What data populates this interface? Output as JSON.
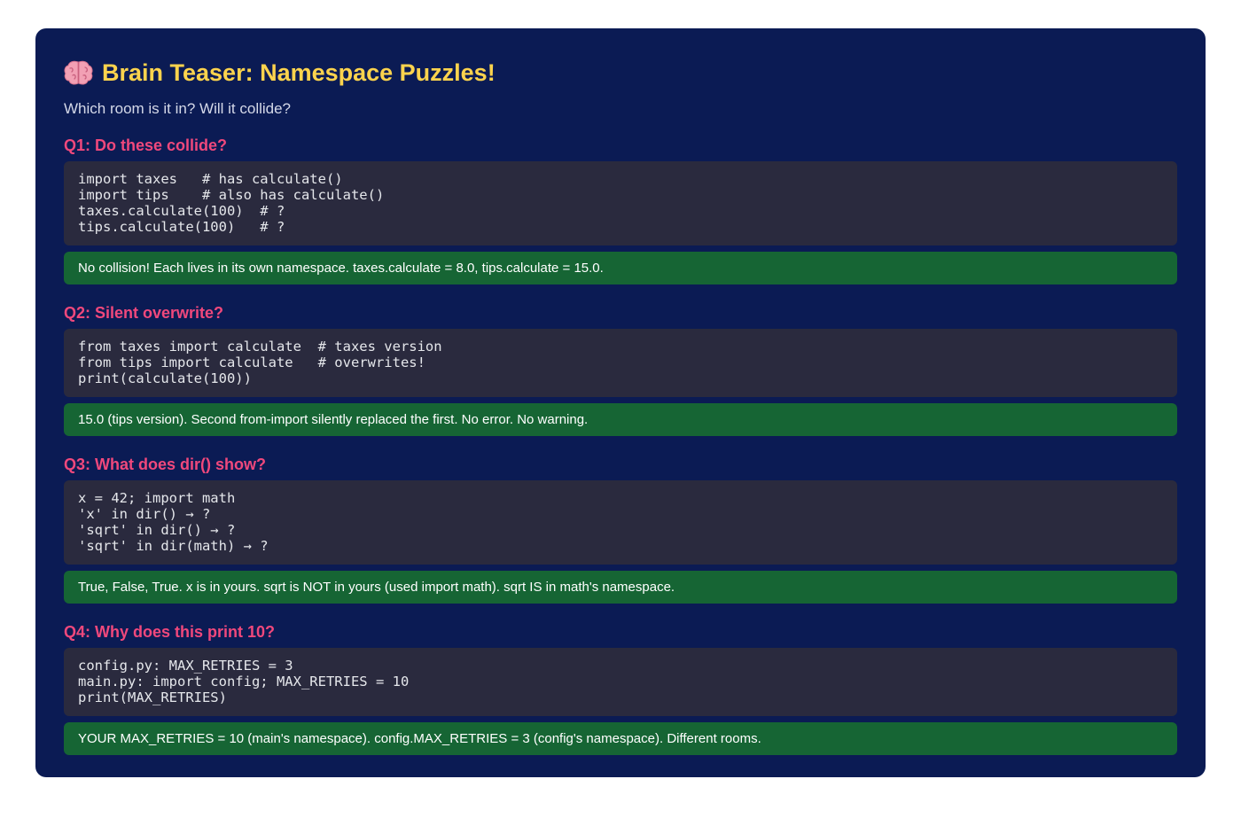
{
  "header": {
    "title": "Brain Teaser: Namespace Puzzles!",
    "icon": "brain-icon",
    "subtitle": "Which room is it in? Will it collide?"
  },
  "colors": {
    "card_background": "#0b1b54",
    "title": "#fcd34d",
    "question": "#f0487c",
    "code_background": "#2a2a3e",
    "answer_background": "#166534"
  },
  "questions": [
    {
      "heading": "Q1: Do these collide?",
      "code": [
        "import taxes   # has calculate()",
        "import tips    # also has calculate()",
        "taxes.calculate(100)  # ?",
        "tips.calculate(100)   # ?"
      ],
      "answer": "No collision! Each lives in its own namespace. taxes.calculate = 8.0, tips.calculate = 15.0."
    },
    {
      "heading": "Q2: Silent overwrite?",
      "code": [
        "from taxes import calculate  # taxes version",
        "from tips import calculate   # overwrites!",
        "print(calculate(100))"
      ],
      "answer": "15.0 (tips version). Second from-import silently replaced the first. No error. No warning."
    },
    {
      "heading": "Q3: What does dir() show?",
      "code": [
        "x = 42; import math",
        "'x' in dir() → ?",
        "'sqrt' in dir() → ?",
        "'sqrt' in dir(math) → ?"
      ],
      "answer": "True, False, True. x is in yours. sqrt is NOT in yours (used import math). sqrt IS in math's namespace."
    },
    {
      "heading": "Q4: Why does this print 10?",
      "code": [
        "config.py: MAX_RETRIES = 3",
        "main.py: import config; MAX_RETRIES = 10",
        "print(MAX_RETRIES)"
      ],
      "answer": "YOUR MAX_RETRIES = 10 (main's namespace). config.MAX_RETRIES = 3 (config's namespace). Different rooms."
    }
  ]
}
